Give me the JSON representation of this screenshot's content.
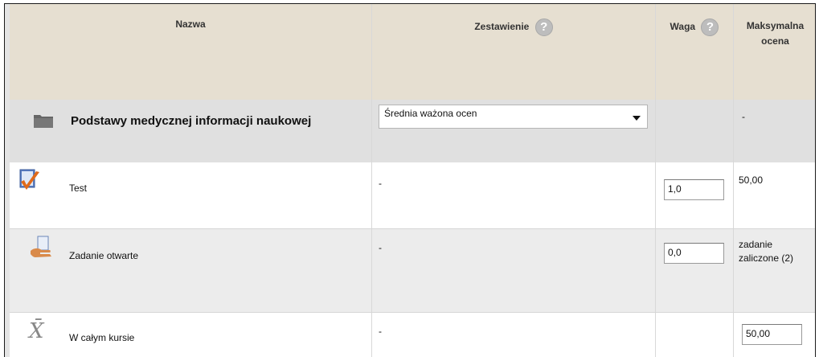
{
  "columns": {
    "name": "Nazwa",
    "aggregation": "Zestawienie",
    "weight": "Waga",
    "max_grade_line1": "Maksymalna",
    "max_grade_line2": "ocena",
    "help_symbol": "?"
  },
  "category": {
    "name": "Podstawy medycznej informacji naukowej",
    "aggregation_selected": "Średnia ważona ocen",
    "max_grade": "-",
    "icon": "folder-icon"
  },
  "items": [
    {
      "name": "Test",
      "aggregation": "-",
      "weight": "1,0",
      "max_grade": "50,00",
      "icon": "quiz-checkmark-icon"
    },
    {
      "name": "Zadanie otwarte",
      "aggregation": "-",
      "weight": "0,0",
      "max_grade_line1": "zadanie",
      "max_grade_line2": "zaliczone (2)",
      "icon": "assignment-icon"
    }
  ],
  "total": {
    "name": "W całym kursie",
    "aggregation": "-",
    "max_grade": "50,00",
    "icon": "x-bar-mean-icon",
    "icon_symbol": "X̄"
  }
}
